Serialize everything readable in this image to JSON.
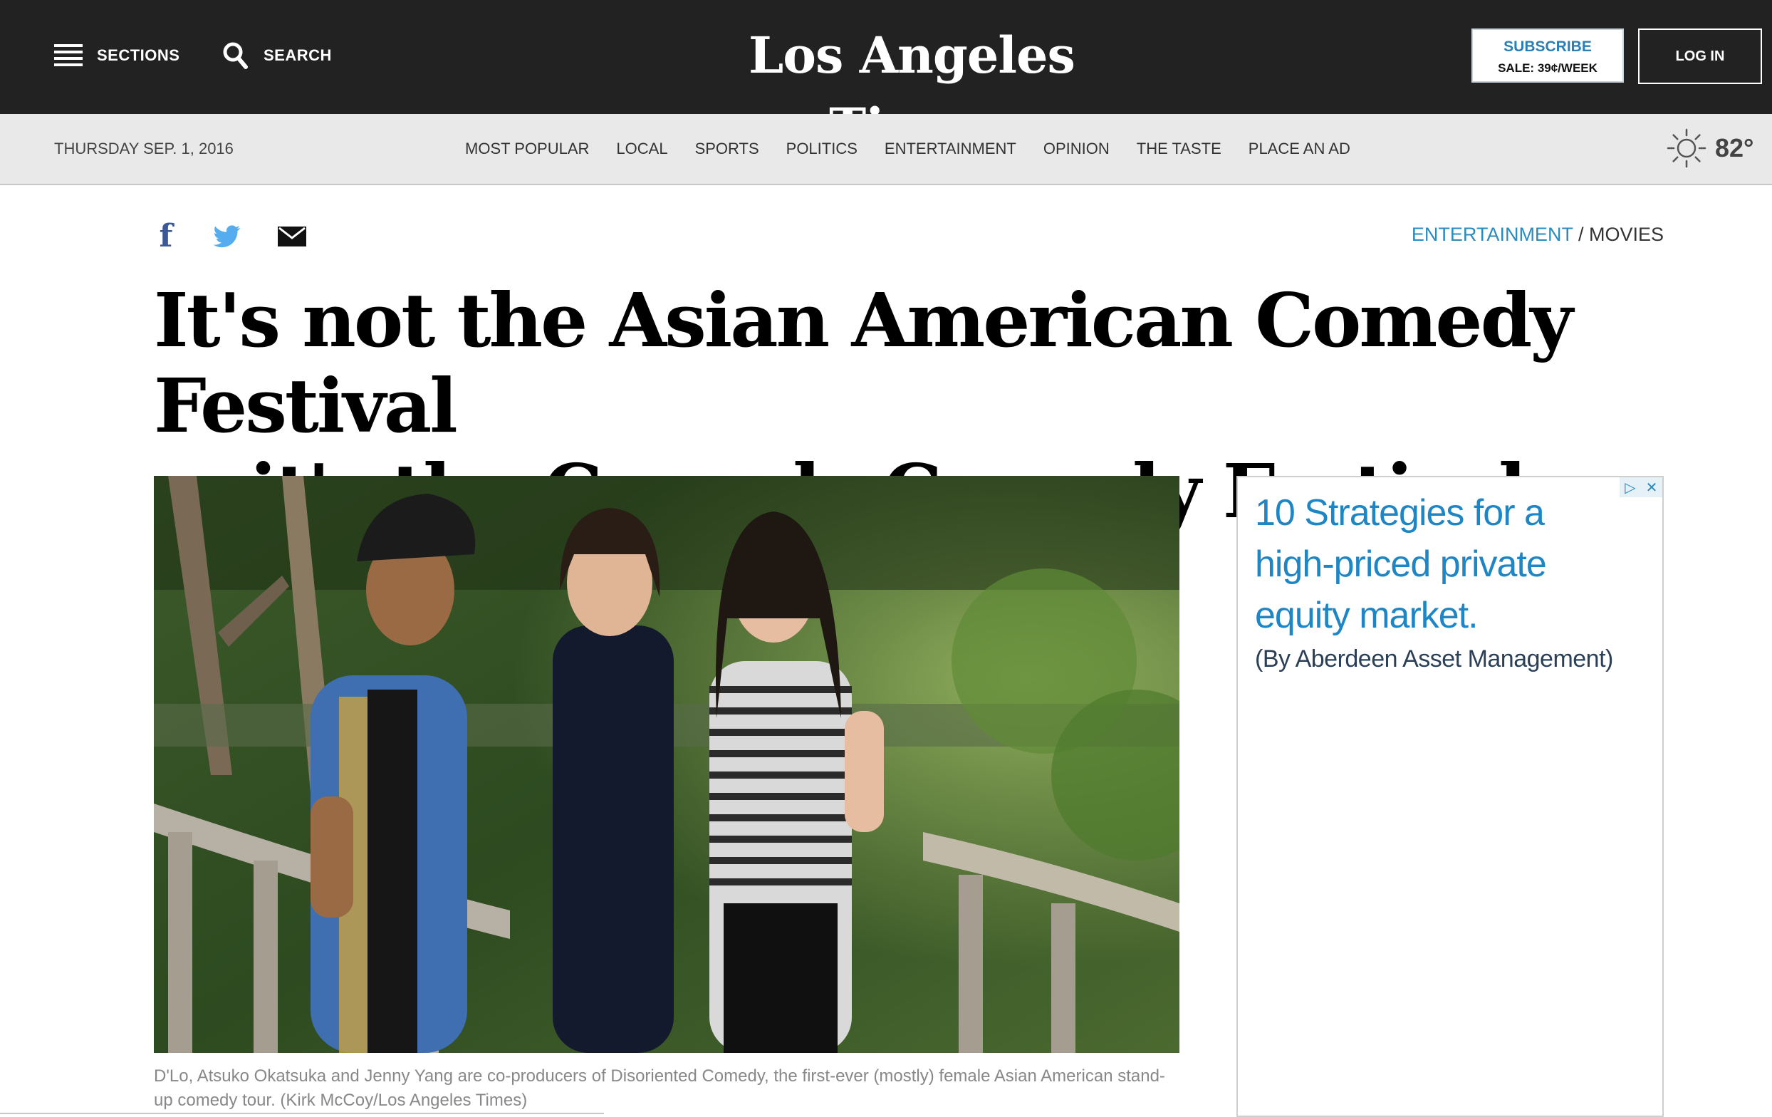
{
  "header": {
    "sections_label": "SECTIONS",
    "search_label": "SEARCH",
    "logo_text": "Los Angeles Times",
    "subscribe_label": "SUBSCRIBE",
    "subscribe_sale": "SALE: 39¢/WEEK",
    "login_label": "LOG IN"
  },
  "nav": {
    "date": "THURSDAY SEP. 1, 2016",
    "links": [
      "MOST POPULAR",
      "LOCAL",
      "SPORTS",
      "POLITICS",
      "ENTERTAINMENT",
      "OPINION",
      "THE TASTE",
      "PLACE AN AD"
    ],
    "weather_icon": "sun-icon",
    "temperature": "82°"
  },
  "article": {
    "social_icons": [
      "facebook-icon",
      "twitter-icon",
      "email-icon"
    ],
    "breadcrumb_section": "ENTERTAINMENT",
    "breadcrumb_separator": " / ",
    "breadcrumb_subsection": "MOVIES",
    "headline_line1": "It's not the Asian American Comedy Festival",
    "headline_line2": "— it's the Comedy Comedy Festival",
    "caption": "D'Lo, Atsuko Okatsuka and Jenny Yang are co-producers of Disoriented Comedy, the first-ever (mostly) female Asian American stand-up comedy tour. (Kirk McCoy/Los Angeles Times)"
  },
  "ad": {
    "headline": "10 Strategies for a high-priced private equity market.",
    "sponsor": "(By Aberdeen Asset Management)",
    "choices_icon": "adchoices-icon",
    "close_icon": "close-icon"
  },
  "colors": {
    "topbar": "#222222",
    "navbar": "#e9e9e9",
    "accent_blue": "#2a8bbd",
    "ad_blue": "#1f86c6"
  }
}
